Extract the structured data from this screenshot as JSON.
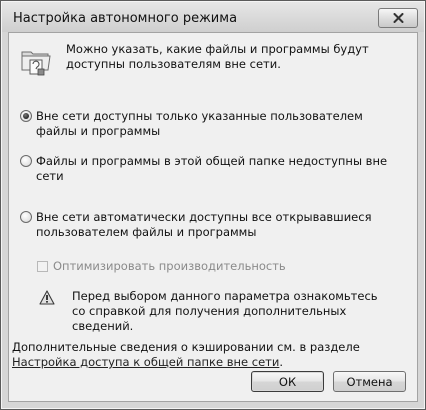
{
  "window": {
    "title": "Настройка автономного режима"
  },
  "intro": {
    "text": "Можно указать, какие файлы и программы будут доступны пользователям вне сети.",
    "icon": "offline-files-icon"
  },
  "options": [
    {
      "label": "Вне сети доступны только указанные пользователем файлы и программы",
      "checked": true
    },
    {
      "label": "Файлы и программы в этой общей папке недоступны вне сети",
      "checked": false
    },
    {
      "label": "Вне сети автоматически доступны все открывавшиеся пользователем файлы и программы",
      "checked": false
    }
  ],
  "optimize": {
    "label": "Оптимизировать производительность",
    "checked": false,
    "enabled": false
  },
  "warning": {
    "icon": "warning-icon",
    "text": "Перед выбором данного параметра ознакомьтесь со справкой для получения дополнительных сведений."
  },
  "footer": {
    "text_before": "Дополнительные сведения о кэшировании см. в разделе ",
    "link": "Настройка доступа к общей папке вне сети",
    "text_after": "."
  },
  "buttons": {
    "ok": "ОК",
    "cancel": "Отмена"
  }
}
